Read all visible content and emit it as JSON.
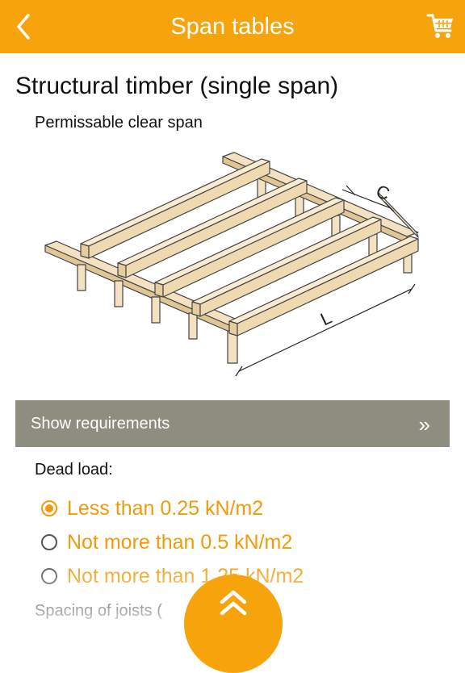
{
  "header": {
    "title": "Span tables",
    "back_icon": "chevron-left-icon",
    "cart_icon": "shopping-cart-icon",
    "background_color": "#F7A30C"
  },
  "content": {
    "title": "Structural timber (single span)",
    "subtitle": "Permissable clear span",
    "diagram": {
      "icon": "timber-joist-frame-diagram",
      "label_spacing": "C",
      "label_length": "L"
    },
    "requirements": {
      "label": "Show requirements",
      "arrow": "»",
      "background_color": "#8E8E80"
    },
    "dead_load": {
      "label": "Dead load:",
      "options": [
        {
          "label": "Less than 0.25 kN/m2",
          "selected": true
        },
        {
          "label": "Not more than 0.5 kN/m2",
          "selected": false
        },
        {
          "label": "Not more than 1.25 kN/m2",
          "selected": false
        }
      ]
    },
    "spacing_label": "Spacing of joists ("
  },
  "scroll_up": {
    "icon": "double-chevron-up-icon"
  },
  "colors": {
    "accent": "#F29A0A"
  }
}
